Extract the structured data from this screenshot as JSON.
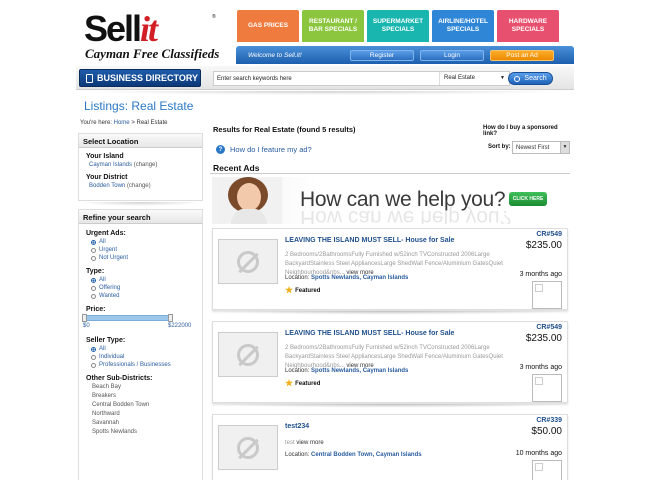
{
  "brand": {
    "logo_main": "Sell",
    "logo_accent": "it",
    "logo_reg": "®",
    "tagline": "Cayman Free Classifieds"
  },
  "tabs": [
    {
      "label": "GAS PRICES",
      "color": "#f07b3f"
    },
    {
      "label": "RESTAURANT / BAR SPECIALS",
      "color": "#8cc63e"
    },
    {
      "label": "SUPERMARKET SPECIALS",
      "color": "#19b6b0"
    },
    {
      "label": "AIRLINE/HOTEL SPECIALS",
      "color": "#2f86d6"
    },
    {
      "label": "HARDWARE SPECIALS",
      "color": "#e8506f"
    }
  ],
  "topbar": {
    "welcome": "Welcome to Sell.it!",
    "register": "Register",
    "login": "Login",
    "post": "Post an Ad"
  },
  "search": {
    "biz_dir": "BUSINESS DIRECTORY",
    "placeholder": "Enter search keywords here",
    "category": "Real Estate",
    "button": "Search"
  },
  "page_title": "Listings: Real Estate",
  "breadcrumb": {
    "prefix": "You're here:",
    "home": "Home",
    "sep": ">",
    "current": "Real Estate"
  },
  "location": {
    "header": "Select Location",
    "island_label": "Your Island",
    "island": "Cayman Islands",
    "island_change": "(change)",
    "district_label": "Your District",
    "district": "Bodden Town",
    "district_change": "(change)"
  },
  "refine": {
    "header": "Refine your search",
    "urgent_label": "Urgent Ads:",
    "urgent_options": [
      "All",
      "Urgent",
      "Not Urgent"
    ],
    "type_label": "Type:",
    "type_options": [
      "All",
      "Offering",
      "Wanted"
    ],
    "price_label": "Price:",
    "price_min": "$0",
    "price_max": "$222000",
    "seller_label": "Seller Type:",
    "seller_options": [
      "All",
      "Individual",
      "Professionals / Businesses"
    ],
    "subdistricts_label": "Other Sub-Districts:",
    "subdistricts": [
      "Beach Bay",
      "Breakers",
      "Central Bodden Town",
      "Northward",
      "Savannah",
      "Spotts Newlands"
    ]
  },
  "results": {
    "header": "Results for Real Estate (found 5 results)",
    "sponsored": "How do I buy a sponsored link?",
    "feature": "How do I feature my ad?",
    "sort_label": "Sort by:",
    "sort_value": "Newest First",
    "recent": "Recent Ads"
  },
  "banner": {
    "text": "How can we help you?",
    "button": "CLICK HERE"
  },
  "ads": [
    {
      "title": "LEAVING THE ISLAND MUST SELL- House for Sale",
      "ref": "CR#549",
      "price": "$235.00",
      "desc": "2 Bedrooms/2BathroomsFully Furnished w/52inch TVConstructed 2006Large BackyardStainless Steel AppliancesLarge ShedWall Fence/Aluminium GatesQuiet Neighbourhood&nbs...",
      "more": "view more",
      "loc_label": "Location:",
      "location": "Spotts Newlands, Cayman Islands",
      "featured": "Featured",
      "ago": "3 months ago"
    },
    {
      "title": "LEAVING THE ISLAND MUST SELL- House for Sale",
      "ref": "CR#549",
      "price": "$235.00",
      "desc": "2 Bedrooms/2BathroomsFully Furnished w/52inch TVConstructed 2006Large BackyardStainless Steel AppliancesLarge ShedWall Fence/Aluminium GatesQuiet Neighbourhood&nbs...",
      "more": "view more",
      "loc_label": "Location:",
      "location": "Spotts Newlands, Cayman Islands",
      "featured": "Featured",
      "ago": "3 months ago"
    },
    {
      "title": "test234",
      "ref": "CR#339",
      "price": "$50.00",
      "desc": "test",
      "more": "view more",
      "loc_label": "Location:",
      "location": "Central Bodden Town, Cayman Islands",
      "ago": "10 months ago"
    }
  ]
}
